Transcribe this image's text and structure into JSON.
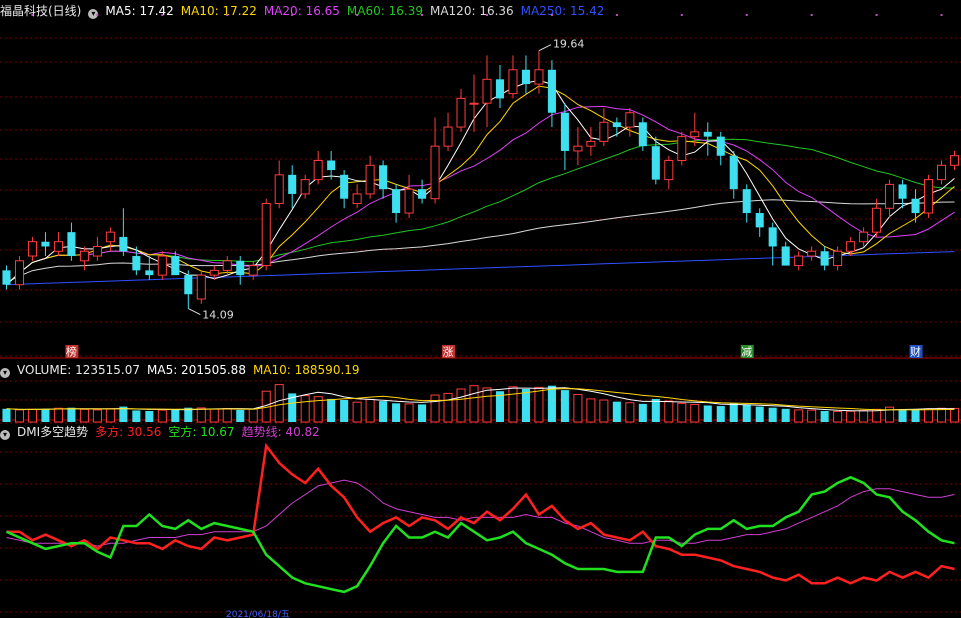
{
  "colors": {
    "up": "#ff3c3c",
    "down": "#3ee0f0",
    "grid": "#7a0000",
    "ma5": "#ffffff",
    "ma10": "#ffd700",
    "ma20": "#e040fb",
    "ma60": "#22c422",
    "ma120": "#d8d8d8",
    "ma250": "#3050ff",
    "dmi_plus": "#ff2020",
    "dmi_minus": "#20e020",
    "dmi_trend": "#d040d0"
  },
  "main": {
    "title": "福晶科技(日线)",
    "toggle_icon": "chevron-down-icon",
    "legend": [
      {
        "name": "MA5",
        "value": "17.42",
        "color": "#ffffff"
      },
      {
        "name": "MA10",
        "value": "17.22",
        "color": "#ffd700"
      },
      {
        "name": "MA20",
        "value": "16.65",
        "color": "#e040fb"
      },
      {
        "name": "MA60",
        "value": "16.39",
        "color": "#22c422"
      },
      {
        "name": "MA120",
        "value": "16.36",
        "color": "#d8d8d8"
      },
      {
        "name": "MA250",
        "value": "15.42",
        "color": "#3050ff"
      }
    ],
    "high_label": "19.64",
    "low_label": "14.09",
    "badges": [
      {
        "text": "榜",
        "index": 5,
        "bg": "#c03030"
      },
      {
        "text": "涨",
        "index": 34,
        "bg": "#c03030"
      },
      {
        "text": "减",
        "index": 57,
        "bg": "#2a8a2a"
      },
      {
        "text": "财",
        "index": 70,
        "bg": "#2050c0"
      }
    ]
  },
  "volume": {
    "title": "VOLUME: 123515.07",
    "ma5_label": "MA5: 201505.88",
    "ma10_label": "MA10: 188590.19"
  },
  "dmi": {
    "title": "DMI多空趋势",
    "plus_label": "多方: 30.56",
    "minus_label": "空方: 10.67",
    "trend_label": "趋势线: 40.82"
  },
  "axis": {
    "date_label": "2021/06/18/五"
  },
  "chart_data": [
    {
      "type": "candlestick",
      "title": "福晶科技(日线)",
      "x_count": 74,
      "ylim": [
        13.5,
        20.2
      ],
      "candles": [
        [
          15.0,
          14.7,
          15.1,
          14.6
        ],
        [
          14.7,
          15.2,
          15.3,
          14.6
        ],
        [
          15.3,
          15.6,
          15.7,
          15.2
        ],
        [
          15.6,
          15.5,
          15.8,
          15.3
        ],
        [
          15.4,
          15.6,
          15.8,
          15.3
        ],
        [
          15.8,
          15.3,
          16.0,
          15.2
        ],
        [
          15.2,
          15.4,
          15.5,
          15.0
        ],
        [
          15.3,
          15.5,
          15.7,
          15.2
        ],
        [
          15.6,
          15.8,
          15.9,
          15.4
        ],
        [
          15.7,
          15.4,
          16.3,
          15.3
        ],
        [
          15.3,
          15.0,
          15.5,
          14.9
        ],
        [
          15.0,
          14.9,
          15.3,
          14.8
        ],
        [
          14.9,
          15.3,
          15.4,
          14.8
        ],
        [
          15.3,
          14.9,
          15.4,
          14.9
        ],
        [
          14.9,
          14.5,
          15.0,
          14.2
        ],
        [
          14.4,
          14.9,
          15.0,
          14.3
        ],
        [
          14.9,
          15.0,
          15.1,
          14.8
        ],
        [
          15.0,
          15.2,
          15.3,
          14.9
        ],
        [
          15.2,
          14.9,
          15.3,
          14.7
        ],
        [
          14.9,
          15.1,
          15.2,
          14.8
        ],
        [
          15.1,
          16.4,
          16.5,
          15.0
        ],
        [
          16.4,
          17.0,
          17.3,
          16.3
        ],
        [
          17.0,
          16.6,
          17.2,
          16.3
        ],
        [
          16.6,
          16.9,
          17.0,
          16.5
        ],
        [
          16.9,
          17.3,
          17.5,
          16.8
        ],
        [
          17.3,
          17.1,
          17.5,
          16.9
        ],
        [
          17.0,
          16.5,
          17.1,
          16.3
        ],
        [
          16.4,
          16.6,
          16.8,
          16.3
        ],
        [
          16.6,
          17.2,
          17.4,
          16.5
        ],
        [
          17.2,
          16.7,
          17.3,
          16.5
        ],
        [
          16.7,
          16.2,
          16.8,
          16.0
        ],
        [
          16.2,
          16.7,
          17.0,
          16.1
        ],
        [
          16.7,
          16.5,
          16.9,
          16.4
        ],
        [
          16.5,
          17.6,
          18.2,
          16.4
        ],
        [
          17.6,
          18.0,
          18.3,
          17.5
        ],
        [
          18.0,
          18.6,
          18.8,
          17.9
        ],
        [
          18.5,
          18.5,
          19.1,
          17.9
        ],
        [
          18.5,
          19.0,
          19.5,
          18.0
        ],
        [
          19.0,
          18.6,
          19.3,
          18.4
        ],
        [
          18.7,
          19.2,
          19.5,
          18.6
        ],
        [
          19.2,
          18.9,
          19.5,
          18.7
        ],
        [
          18.9,
          19.2,
          19.6,
          18.7
        ],
        [
          19.2,
          18.3,
          19.4,
          18.0
        ],
        [
          18.3,
          17.5,
          18.5,
          17.1
        ],
        [
          17.5,
          17.6,
          18.0,
          17.2
        ],
        [
          17.6,
          17.7,
          18.0,
          17.4
        ],
        [
          17.7,
          18.1,
          18.4,
          17.6
        ],
        [
          18.1,
          18.0,
          18.2,
          17.8
        ],
        [
          18.0,
          18.3,
          18.4,
          17.8
        ],
        [
          18.1,
          17.6,
          18.2,
          17.5
        ],
        [
          17.6,
          16.9,
          17.8,
          16.8
        ],
        [
          16.9,
          17.3,
          17.4,
          16.7
        ],
        [
          17.3,
          17.8,
          17.9,
          17.2
        ],
        [
          17.8,
          17.9,
          18.3,
          17.6
        ],
        [
          17.9,
          17.8,
          18.1,
          17.4
        ],
        [
          17.8,
          17.4,
          17.9,
          17.2
        ],
        [
          17.4,
          16.7,
          17.5,
          16.5
        ],
        [
          16.7,
          16.2,
          16.8,
          16.0
        ],
        [
          16.2,
          15.9,
          16.3,
          15.7
        ],
        [
          15.9,
          15.5,
          16.0,
          15.1
        ],
        [
          15.5,
          15.1,
          15.6,
          15.1
        ],
        [
          15.1,
          15.3,
          15.4,
          15.0
        ],
        [
          15.3,
          15.4,
          15.5,
          15.2
        ],
        [
          15.4,
          15.1,
          15.5,
          15.0
        ],
        [
          15.1,
          15.4,
          15.5,
          15.0
        ],
        [
          15.4,
          15.6,
          15.7,
          15.3
        ],
        [
          15.6,
          15.8,
          15.9,
          15.5
        ],
        [
          15.8,
          16.3,
          16.5,
          15.7
        ],
        [
          16.3,
          16.8,
          16.9,
          16.1
        ],
        [
          16.8,
          16.5,
          16.9,
          16.3
        ],
        [
          16.5,
          16.2,
          16.7,
          16.0
        ],
        [
          16.2,
          16.9,
          17.0,
          16.1
        ],
        [
          16.9,
          17.2,
          17.3,
          16.8
        ],
        [
          17.2,
          17.4,
          17.5,
          17.1
        ]
      ]
    },
    {
      "type": "bar",
      "title": "VOLUME: 123515.07",
      "ylim": [
        0,
        400000
      ],
      "values": [
        120000,
        110000,
        115000,
        120000,
        125000,
        130000,
        115000,
        110000,
        120000,
        140000,
        105000,
        100000,
        108000,
        112000,
        130000,
        128000,
        118000,
        122000,
        110000,
        118000,
        280000,
        340000,
        260000,
        240000,
        230000,
        210000,
        200000,
        180000,
        205000,
        190000,
        170000,
        165000,
        160000,
        245000,
        260000,
        300000,
        330000,
        310000,
        280000,
        320000,
        300000,
        315000,
        330000,
        290000,
        250000,
        210000,
        200000,
        185000,
        175000,
        165000,
        210000,
        190000,
        170000,
        160000,
        150000,
        145000,
        170000,
        155000,
        140000,
        130000,
        120000,
        110000,
        108000,
        100000,
        96000,
        98000,
        104000,
        115000,
        135000,
        118000,
        112000,
        120000,
        125000,
        123500
      ]
    },
    {
      "type": "line",
      "title": "DMI多空趋势",
      "ylim": [
        0,
        60
      ],
      "series": [
        {
          "name": "多方",
          "values": [
            28,
            28,
            25,
            27,
            25,
            23,
            25,
            22,
            26,
            25,
            24,
            24,
            22,
            25,
            23,
            22,
            26,
            25,
            26,
            27,
            58,
            52,
            48,
            45,
            50,
            44,
            40,
            33,
            28,
            31,
            33,
            30,
            33,
            32,
            29,
            33,
            31,
            35,
            32,
            36,
            41,
            34,
            37,
            32,
            29,
            31,
            27,
            26,
            25,
            28,
            23,
            22,
            20,
            20,
            19,
            18,
            16,
            15,
            14,
            12,
            11,
            13,
            10,
            10,
            12,
            10,
            12,
            11,
            14,
            12,
            14,
            12,
            16,
            15
          ]
        },
        {
          "name": "空方",
          "values": [
            28,
            26,
            24,
            22,
            23,
            24,
            24,
            21,
            19,
            30,
            30,
            34,
            30,
            29,
            32,
            29,
            31,
            30,
            29,
            28,
            20,
            16,
            12,
            10,
            9,
            8,
            7,
            9,
            16,
            24,
            30,
            26,
            26,
            28,
            26,
            31,
            28,
            25,
            26,
            28,
            24,
            22,
            20,
            17,
            15,
            15,
            15,
            14,
            14,
            14,
            26,
            26,
            23,
            27,
            29,
            29,
            32,
            29,
            30,
            30,
            33,
            35,
            41,
            42,
            45,
            47,
            45,
            41,
            40,
            35,
            32,
            28,
            25,
            24
          ]
        },
        {
          "name": "趋势线",
          "values": [
            26,
            25,
            24,
            24,
            24,
            24,
            24,
            23,
            24,
            24,
            25,
            26,
            26,
            26,
            27,
            27,
            28,
            28,
            28,
            28,
            30,
            34,
            38,
            41,
            44,
            45,
            46,
            45,
            42,
            38,
            36,
            35,
            34,
            33,
            33,
            32,
            33,
            33,
            33,
            33,
            34,
            33,
            33,
            31,
            30,
            28,
            26,
            25,
            24,
            24,
            25,
            25,
            24,
            24,
            25,
            25,
            26,
            27,
            27,
            28,
            29,
            31,
            33,
            35,
            37,
            40,
            42,
            43,
            43,
            42,
            41,
            40,
            40,
            41
          ]
        }
      ]
    }
  ]
}
